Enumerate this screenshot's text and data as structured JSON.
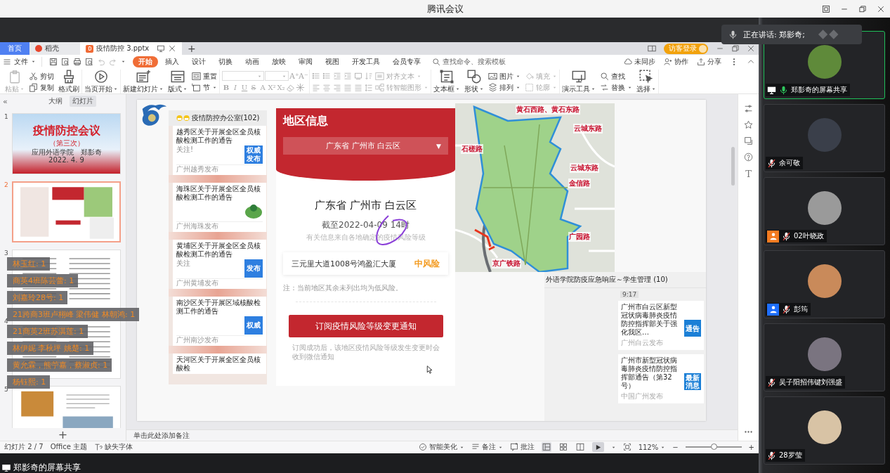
{
  "window": {
    "title": "腾讯会议"
  },
  "speaking_toast": {
    "label": "正在讲话: 郑影奇;"
  },
  "share_caption": "郑影奇的屏幕共享",
  "wps": {
    "tabs": [
      {
        "label": "首页",
        "kind": "home",
        "selected": false
      },
      {
        "label": "稻壳",
        "kind": "docer",
        "selected": false
      },
      {
        "label": "疫情防控 3.pptx",
        "kind": "file",
        "selected": true
      }
    ],
    "add_tab": "+",
    "login": "访客登录",
    "file_menu": "文件",
    "menu_tabs": [
      {
        "label": "开始",
        "selected": true
      },
      {
        "label": "插入",
        "selected": false
      },
      {
        "label": "设计",
        "selected": false
      },
      {
        "label": "切换",
        "selected": false
      },
      {
        "label": "动画",
        "selected": false
      },
      {
        "label": "放映",
        "selected": false
      },
      {
        "label": "审阅",
        "selected": false
      },
      {
        "label": "视图",
        "selected": false
      },
      {
        "label": "开发工具",
        "selected": false
      },
      {
        "label": "会员专享",
        "selected": false
      }
    ],
    "search": {
      "placeholder": "查找命令、搜索模板"
    },
    "actions": [
      "未同步",
      "协作",
      "分享"
    ],
    "ribbon": [
      {
        "kind": "tools",
        "columns": [
          {
            "tools": [
              {
                "label": "粘贴",
                "kind": "large",
                "disabled": true,
                "dropdown": true
              }
            ]
          },
          {
            "tools": [
              {
                "label": "剪切",
                "kind": "small",
                "disabled": false,
                "dropdown": false
              },
              {
                "label": "复制",
                "kind": "small",
                "disabled": false,
                "dropdown": false
              }
            ]
          },
          {
            "tools": [
              {
                "label": "格式刷",
                "kind": "large",
                "disabled": false,
                "dropdown": false
              }
            ]
          }
        ]
      },
      {
        "kind": "tools",
        "columns": [
          {
            "tools": [
              {
                "label": "当页开始",
                "kind": "large",
                "disabled": false,
                "dropdown": true
              }
            ]
          }
        ]
      },
      {
        "kind": "tools",
        "columns": [
          {
            "tools": [
              {
                "label": "新建幻灯片",
                "kind": "large",
                "disabled": false,
                "dropdown": true
              }
            ]
          },
          {
            "tools": [
              {
                "label": "版式",
                "kind": "large",
                "disabled": false,
                "dropdown": true
              }
            ]
          },
          {
            "tools": [
              {
                "label": "重置",
                "kind": "small",
                "disabled": false,
                "dropdown": false
              },
              {
                "label": "节",
                "kind": "small",
                "disabled": false,
                "dropdown": true
              }
            ]
          }
        ]
      },
      {
        "kind": "font",
        "size_buttons": [
          "A⁺",
          "A⁻"
        ],
        "format_buttons": [
          "B",
          "I",
          "U",
          "S",
          "A",
          "X²",
          "X₂"
        ]
      },
      {
        "kind": "paragraph",
        "columns": [
          {
            "tools": [
              {
                "label": "对齐文本",
                "kind": "small",
                "disabled": true,
                "dropdown": true
              },
              {
                "label": "转智能图形",
                "kind": "small",
                "disabled": true,
                "dropdown": true
              }
            ]
          }
        ]
      },
      {
        "kind": "tools",
        "columns": [
          {
            "tools": [
              {
                "label": "文本框",
                "kind": "large",
                "disabled": false,
                "dropdown": true
              }
            ]
          },
          {
            "tools": [
              {
                "label": "形状",
                "kind": "large",
                "disabled": false,
                "dropdown": true
              }
            ]
          },
          {
            "tools": [
              {
                "label": "图片",
                "kind": "small",
                "disabled": false,
                "dropdown": true
              },
              {
                "label": "排列",
                "kind": "small",
                "disabled": false,
                "dropdown": true
              }
            ]
          },
          {
            "tools": [
              {
                "label": "填充",
                "kind": "small",
                "disabled": true,
                "dropdown": true
              },
              {
                "label": "轮廓",
                "kind": "small",
                "disabled": true,
                "dropdown": true
              }
            ]
          }
        ]
      },
      {
        "kind": "tools",
        "columns": [
          {
            "tools": [
              {
                "label": "演示工具",
                "kind": "large",
                "disabled": false,
                "dropdown": true
              }
            ]
          },
          {
            "tools": [
              {
                "label": "查找",
                "kind": "small",
                "disabled": false,
                "dropdown": false
              },
              {
                "label": "替换",
                "kind": "small",
                "disabled": false,
                "dropdown": true
              }
            ]
          },
          {
            "tools": [
              {
                "label": "选择",
                "kind": "large",
                "disabled": false,
                "dropdown": true
              }
            ]
          }
        ]
      }
    ],
    "collapse": "«",
    "panel_tabs": [
      {
        "label": "大纲",
        "selected": false
      },
      {
        "label": "幻灯片",
        "selected": true
      }
    ],
    "thumbnails": [
      {
        "number": "1",
        "kind": "title",
        "selected": false,
        "title": "疫情防控会议",
        "subtitle": "（第三次）",
        "author": "应用外语学院　郑影奇",
        "date": "2022. 4. 9"
      },
      {
        "number": "2",
        "kind": "collage",
        "selected": true
      },
      {
        "number": "3",
        "kind": "document",
        "selected": false
      },
      {
        "number": "4",
        "kind": "document",
        "selected": false
      },
      {
        "number": "5",
        "kind": "photos",
        "selected": false
      }
    ],
    "comments": [
      "林玉红: 1",
      "商英4班陈芸蕾: 1",
      "刘嘉玲28号: 1",
      "21跨商3班卢栩峰 梁伟健 林朝鸿: 1",
      "21商英2班苏淇莲: 1",
      "林伊妮 李秋坪 姚楚: 1",
      "黄允霖，熊苧嘉，蔡淑贞: 1",
      "杨钰熙: 1"
    ],
    "add_slide": "+",
    "side_text_tool": "T",
    "notes_placeholder": "单击此处添加备注",
    "status": {
      "slide": "幻灯片 2 / 7",
      "theme": "Office 主题",
      "missing_font": "缺失字体",
      "beautify": "智能美化",
      "notes": "备注",
      "comment": "批注",
      "views": [
        {
          "selected": true
        },
        {
          "selected": false
        },
        {
          "selected": false
        }
      ],
      "zoom": "112%",
      "zoom_out": "−",
      "zoom_in": "+",
      "zoom_slider": {
        "level": 0.5
      }
    }
  },
  "slide": {
    "feed": {
      "title": "疫情防控办公室(102)",
      "cards": [
        {
          "title": "越秀区关于开展全区全员核酸检测工作的通告",
          "note": "关注!",
          "kind": "text-badge",
          "badge": "权威发布",
          "source": "广州越秀发布"
        },
        {
          "title": "海珠区关于开展全区全员核酸检测工作的通告",
          "kind": "emblem",
          "source": "广州海珠发布"
        },
        {
          "title": "黄埔区关于开展全区全员核酸检测工作的通告",
          "note": "关注",
          "kind": "text-badge",
          "badge": "发布",
          "source": "广州黄埔发布"
        },
        {
          "title": "南沙区关于开展区域核酸检测工作的通告",
          "kind": "text-badge",
          "badge": "权威",
          "source": "广州南沙发布"
        },
        {
          "title": "天河区关于开展全区全员核酸检",
          "kind": "partial"
        }
      ]
    },
    "region": {
      "title": "地区信息",
      "dropdown": "广东省 广州市 白云区",
      "dropdown_caret": "▼",
      "heading": "广东省 广州市 白云区",
      "as_of": "截至2022-04-09 14时",
      "source_note": "有关信息来自各地确定的疫情风险等级",
      "areas": [
        {
          "name": "三元里大道1008号鸿盈汇大厦",
          "risk": "中风险"
        }
      ],
      "note": "注：当前地区其余未列出均为低风险。",
      "subscribe": "订阅疫情风险等级变更通知",
      "subscribe_note": "订阅成功后，该地区疫情风险等级发生变更时会收到微信通知"
    },
    "map": {
      "labels": [
        "黄石西路、黄石东路",
        "云城东路",
        "石槎路",
        "云城东路",
        "金信路",
        "广园路",
        "京广铁路"
      ]
    },
    "chat": {
      "title": "外语学院防疫应急响应～学生管理 (10)",
      "time": "9:17",
      "messages": [
        {
          "title": "广州市白云区新型冠状病毒肺炎疫情防控指挥部关于强化我区…",
          "badge": "通告",
          "source": "广州白云发布"
        },
        {
          "title": "广州市新型冠状病毒肺炎疫情防控指挥部通告（第32号）",
          "badge": "最新消息",
          "source": "中国广州发布"
        }
      ]
    }
  },
  "participants": [
    {
      "name": "郑影奇的屏幕共享",
      "sharing": true,
      "muted": false,
      "speaking": true
    },
    {
      "name": "余可敬",
      "sharing": false,
      "muted": true,
      "speaking": false
    },
    {
      "name": "02叶晓政",
      "sharing": false,
      "muted": true,
      "speaking": false,
      "color": "#f47b20"
    },
    {
      "name": "彭筠",
      "sharing": false,
      "muted": true,
      "speaking": false,
      "color": "#1e6fff"
    },
    {
      "name": "吴子阳招伟键刘强盛",
      "sharing": false,
      "muted": true,
      "speaking": false
    },
    {
      "name": "28罗莹",
      "sharing": false,
      "muted": true,
      "speaking": false
    }
  ]
}
